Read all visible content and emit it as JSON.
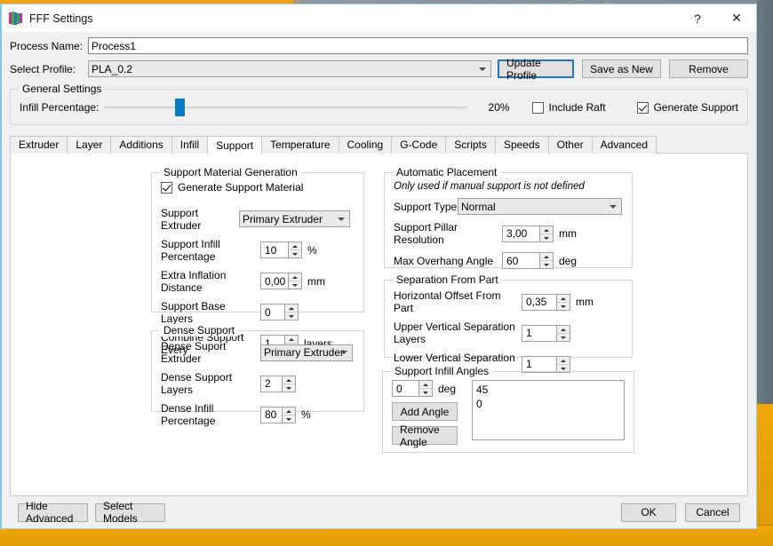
{
  "window": {
    "title": "FFF Settings",
    "icon": "app-cube-icon",
    "help_label": "?",
    "close_label": "✕"
  },
  "top_form": {
    "process_name_label": "Process Name:",
    "process_name_value": "Process1",
    "select_profile_label": "Select Profile:",
    "select_profile_value": "PLA_0.2",
    "update_profile_label": "Update Profile",
    "save_as_new_label": "Save as New",
    "remove_label": "Remove"
  },
  "general_settings": {
    "legend": "General Settings",
    "infill_label": "Infill Percentage:",
    "infill_value": "20%",
    "infill_percent": 20,
    "include_raft_label": "Include Raft",
    "include_raft_checked": false,
    "generate_support_label": "Generate Support",
    "generate_support_checked": true
  },
  "tabs": [
    {
      "label": "Extruder",
      "active": false
    },
    {
      "label": "Layer",
      "active": false
    },
    {
      "label": "Additions",
      "active": false
    },
    {
      "label": "Infill",
      "active": false
    },
    {
      "label": "Support",
      "active": true
    },
    {
      "label": "Temperature",
      "active": false
    },
    {
      "label": "Cooling",
      "active": false
    },
    {
      "label": "G-Code",
      "active": false
    },
    {
      "label": "Scripts",
      "active": false
    },
    {
      "label": "Speeds",
      "active": false
    },
    {
      "label": "Other",
      "active": false
    },
    {
      "label": "Advanced",
      "active": false
    }
  ],
  "support_material_generation": {
    "legend": "Support Material Generation",
    "generate_support_material_label": "Generate Support Material",
    "generate_support_material_checked": true,
    "support_extruder_label": "Support Extruder",
    "support_extruder_value": "Primary Extruder",
    "support_infill_percentage_label": "Support Infill Percentage",
    "support_infill_percentage_value": "10",
    "support_infill_percentage_unit": "%",
    "extra_inflation_distance_label": "Extra Inflation Distance",
    "extra_inflation_distance_value": "0,00",
    "extra_inflation_distance_unit": "mm",
    "support_base_layers_label": "Support Base Layers",
    "support_base_layers_value": "0",
    "combine_support_every_label": "Combine Support Every",
    "combine_support_every_value": "1",
    "combine_support_every_unit": "layers"
  },
  "dense_support": {
    "legend": "Dense Support",
    "dense_support_extruder_label": "Dense Suport Extruder",
    "dense_support_extruder_value": "Primary Extruder",
    "dense_support_layers_label": "Dense Support Layers",
    "dense_support_layers_value": "2",
    "dense_infill_percentage_label": "Dense Infill Percentage",
    "dense_infill_percentage_value": "80",
    "dense_infill_percentage_unit": "%"
  },
  "automatic_placement": {
    "legend": "Automatic Placement",
    "note": "Only used if manual support is not defined",
    "support_type_label": "Support Type",
    "support_type_value": "Normal",
    "support_pillar_resolution_label": "Support Pillar Resolution",
    "support_pillar_resolution_value": "3,00",
    "support_pillar_resolution_unit": "mm",
    "max_overhang_angle_label": "Max Overhang Angle",
    "max_overhang_angle_value": "60",
    "max_overhang_angle_unit": "deg"
  },
  "separation_from_part": {
    "legend": "Separation From Part",
    "horizontal_offset_label": "Horizontal Offset From Part",
    "horizontal_offset_value": "0,35",
    "horizontal_offset_unit": "mm",
    "upper_vertical_label": "Upper Vertical Separation Layers",
    "upper_vertical_value": "1",
    "lower_vertical_label": "Lower Vertical Separation Layers",
    "lower_vertical_value": "1"
  },
  "support_infill_angles": {
    "legend": "Support Infill Angles",
    "angle_value": "0",
    "angle_unit": "deg",
    "add_angle_label": "Add Angle",
    "remove_angle_label": "Remove Angle",
    "angles": [
      "45",
      "0"
    ]
  },
  "footer": {
    "hide_advanced_label": "Hide Advanced",
    "select_models_label": "Select Models",
    "ok_label": "OK",
    "cancel_label": "Cancel"
  },
  "colors": {
    "accent": "#0a7ac2",
    "primary_border": "#2a74b5",
    "dialog_bg": "#f0f0f0",
    "desktop_orange": "#f0a808"
  }
}
